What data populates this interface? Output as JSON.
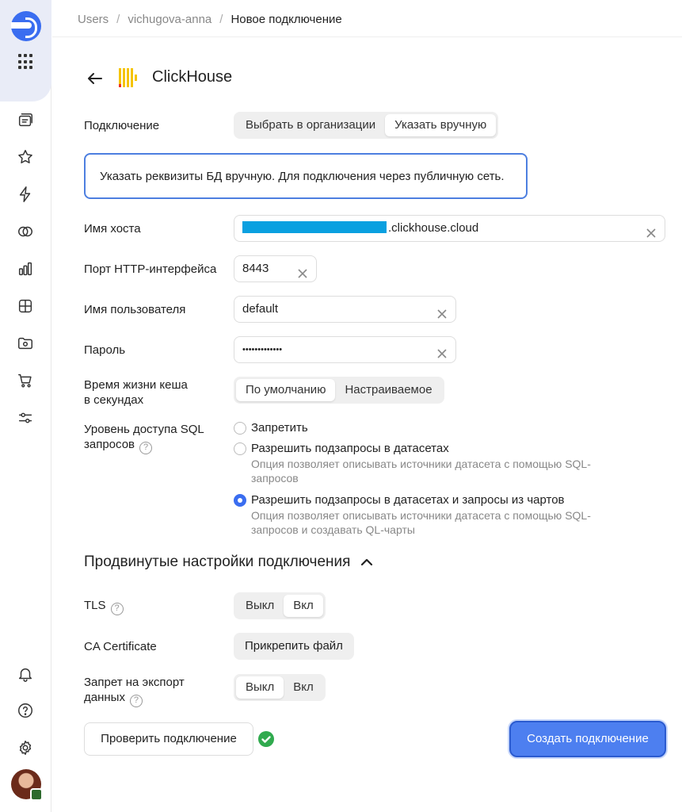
{
  "breadcrumb": {
    "items": [
      "Users",
      "vichugova-anna"
    ],
    "separator": "/",
    "current": "Новое подключение"
  },
  "header": {
    "back_icon": "arrow-left-icon",
    "logo_icon": "clickhouse-logo",
    "title": "ClickHouse"
  },
  "connection": {
    "label": "Подключение",
    "options": [
      "Выбрать в организации",
      "Указать вручную"
    ],
    "selected": "Указать вручную"
  },
  "info_text": "Указать реквизиты БД вручную. Для подключения через публичную сеть.",
  "host": {
    "label": "Имя хоста",
    "value_suffix": ".clickhouse.cloud"
  },
  "port": {
    "label": "Порт HTTP-интерфейса",
    "value": "8443"
  },
  "username": {
    "label": "Имя пользователя",
    "value": "default"
  },
  "password": {
    "label": "Пароль",
    "value": "•••••••••••••"
  },
  "cache": {
    "label_line1": "Время жизни кеша",
    "label_line2": "в секундах",
    "options": [
      "По умолчанию",
      "Настраиваемое"
    ],
    "selected": "По умолчанию"
  },
  "sql_access": {
    "label_line1": "Уровень доступа SQL",
    "label_line2": "запросов",
    "help": "?",
    "options": [
      {
        "title": "Запретить",
        "desc": "",
        "checked": false
      },
      {
        "title": "Разрешить подзапросы в датасетах",
        "desc": "Опция позволяет описывать источники датасета с помощью SQL-запросов",
        "checked": false
      },
      {
        "title": "Разрешить подзапросы в датасетах и запросы из чартов",
        "desc": "Опция позволяет описывать источники датасета с помощью SQL-запросов и создавать QL-чарты",
        "checked": true
      }
    ]
  },
  "advanced": {
    "title": "Продвинутые настройки подключения",
    "expanded": true,
    "tls": {
      "label": "TLS",
      "help": "?",
      "options": [
        "Выкл",
        "Вкл"
      ],
      "selected": "Вкл"
    },
    "ca_cert": {
      "label": "CA Certificate",
      "button": "Прикрепить файл"
    },
    "export_ban": {
      "label_line1": "Запрет на экспорт",
      "label_line2": "данных",
      "help": "?",
      "options": [
        "Выкл",
        "Вкл"
      ],
      "selected": "Выкл"
    }
  },
  "footer": {
    "check_button": "Проверить подключение",
    "check_status": "ok",
    "create_button": "Создать подключение"
  },
  "colors": {
    "accent": "#4d7ff0",
    "success": "#30aa4e",
    "redacted": "#0aa0e0"
  }
}
